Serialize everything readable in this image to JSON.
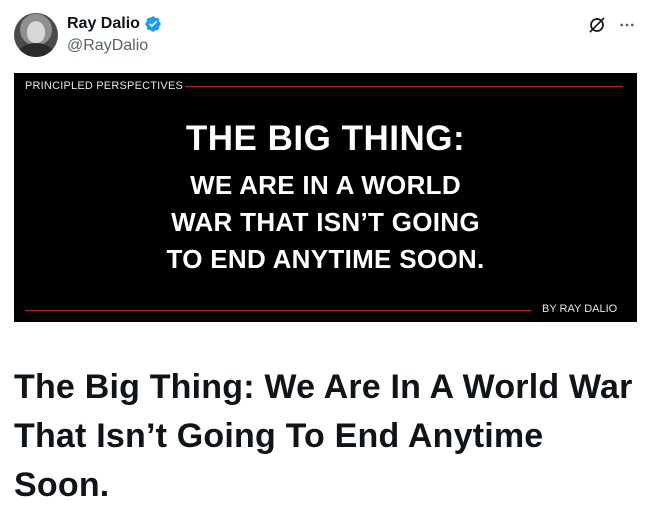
{
  "author": {
    "display_name": "Ray Dalio",
    "handle": "@RayDalio",
    "verified": true,
    "verified_color": "#1d9bf0"
  },
  "icons": {
    "grok": "grok-icon",
    "more": "more-icon",
    "verified": "verified-badge-icon"
  },
  "media": {
    "series_label": "PRINCIPLED PERSPECTIVES",
    "headline_line1": "THE BIG THING:",
    "headline_line2": "WE ARE IN A WORLD",
    "headline_line3": "WAR THAT ISN’T GOING",
    "headline_line4": "TO END ANYTIME SOON.",
    "byline": "BY RAY DALIO",
    "rule_color": "#b3261e",
    "background": "#000000"
  },
  "article": {
    "title": "The Big Thing: We Are In A World War That Isn’t Going To End Anytime Soon."
  }
}
